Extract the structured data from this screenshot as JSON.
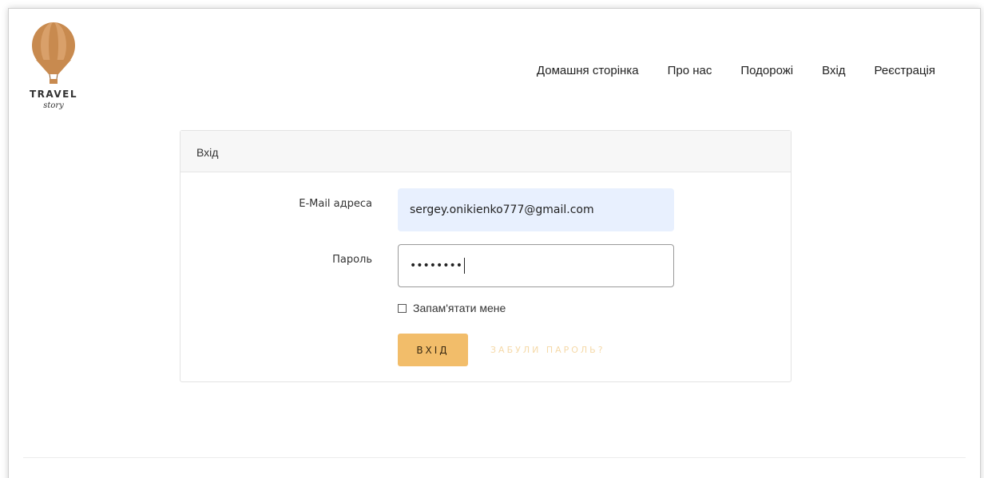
{
  "brand": {
    "logo_word": "TRAVEL",
    "logo_script": "story",
    "balloon_color": "#c88a4f"
  },
  "nav": {
    "items": [
      {
        "label": "Домашня сторінка"
      },
      {
        "label": "Про нас"
      },
      {
        "label": "Подорожі"
      },
      {
        "label": "Вхід"
      },
      {
        "label": "Реєстрація"
      }
    ]
  },
  "login": {
    "title": "Вхід",
    "email_label": "E-Mail адреса",
    "email_value": "sergey.onikienko777@gmail.com",
    "password_label": "Пароль",
    "password_masked": "••••••••",
    "remember_label": "Запам'ятати мене",
    "remember_checked": false,
    "submit_label": "ВХІД",
    "forgot_label": "ЗАБУЛИ ПАРОЛЬ?"
  },
  "colors": {
    "accent": "#f2bd6a",
    "email_fill": "#e8f0fe"
  }
}
